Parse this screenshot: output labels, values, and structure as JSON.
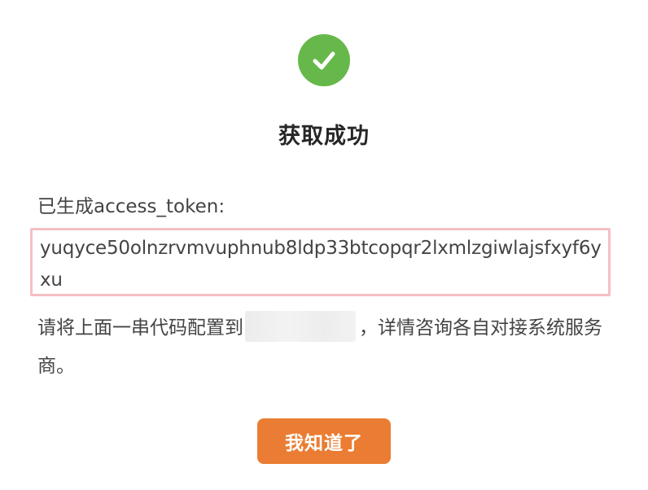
{
  "dialog": {
    "title": "获取成功",
    "token_label": "已生成access_token:",
    "token_value": "yuqyce50olnzrvmvuphnub8ldp33btcopqr2lxmlzgiwlajsfxyf6yxu",
    "instruction_before": "请将上面一串代码配置到",
    "instruction_after": "，详情咨询各自对接系统服务商。",
    "ok_button_label": "我知道了"
  },
  "icons": {
    "success": "check-circle-icon"
  },
  "colors": {
    "success_green": "#67b84a",
    "button_orange": "#ea7d33",
    "token_border": "#f5bfc4"
  }
}
